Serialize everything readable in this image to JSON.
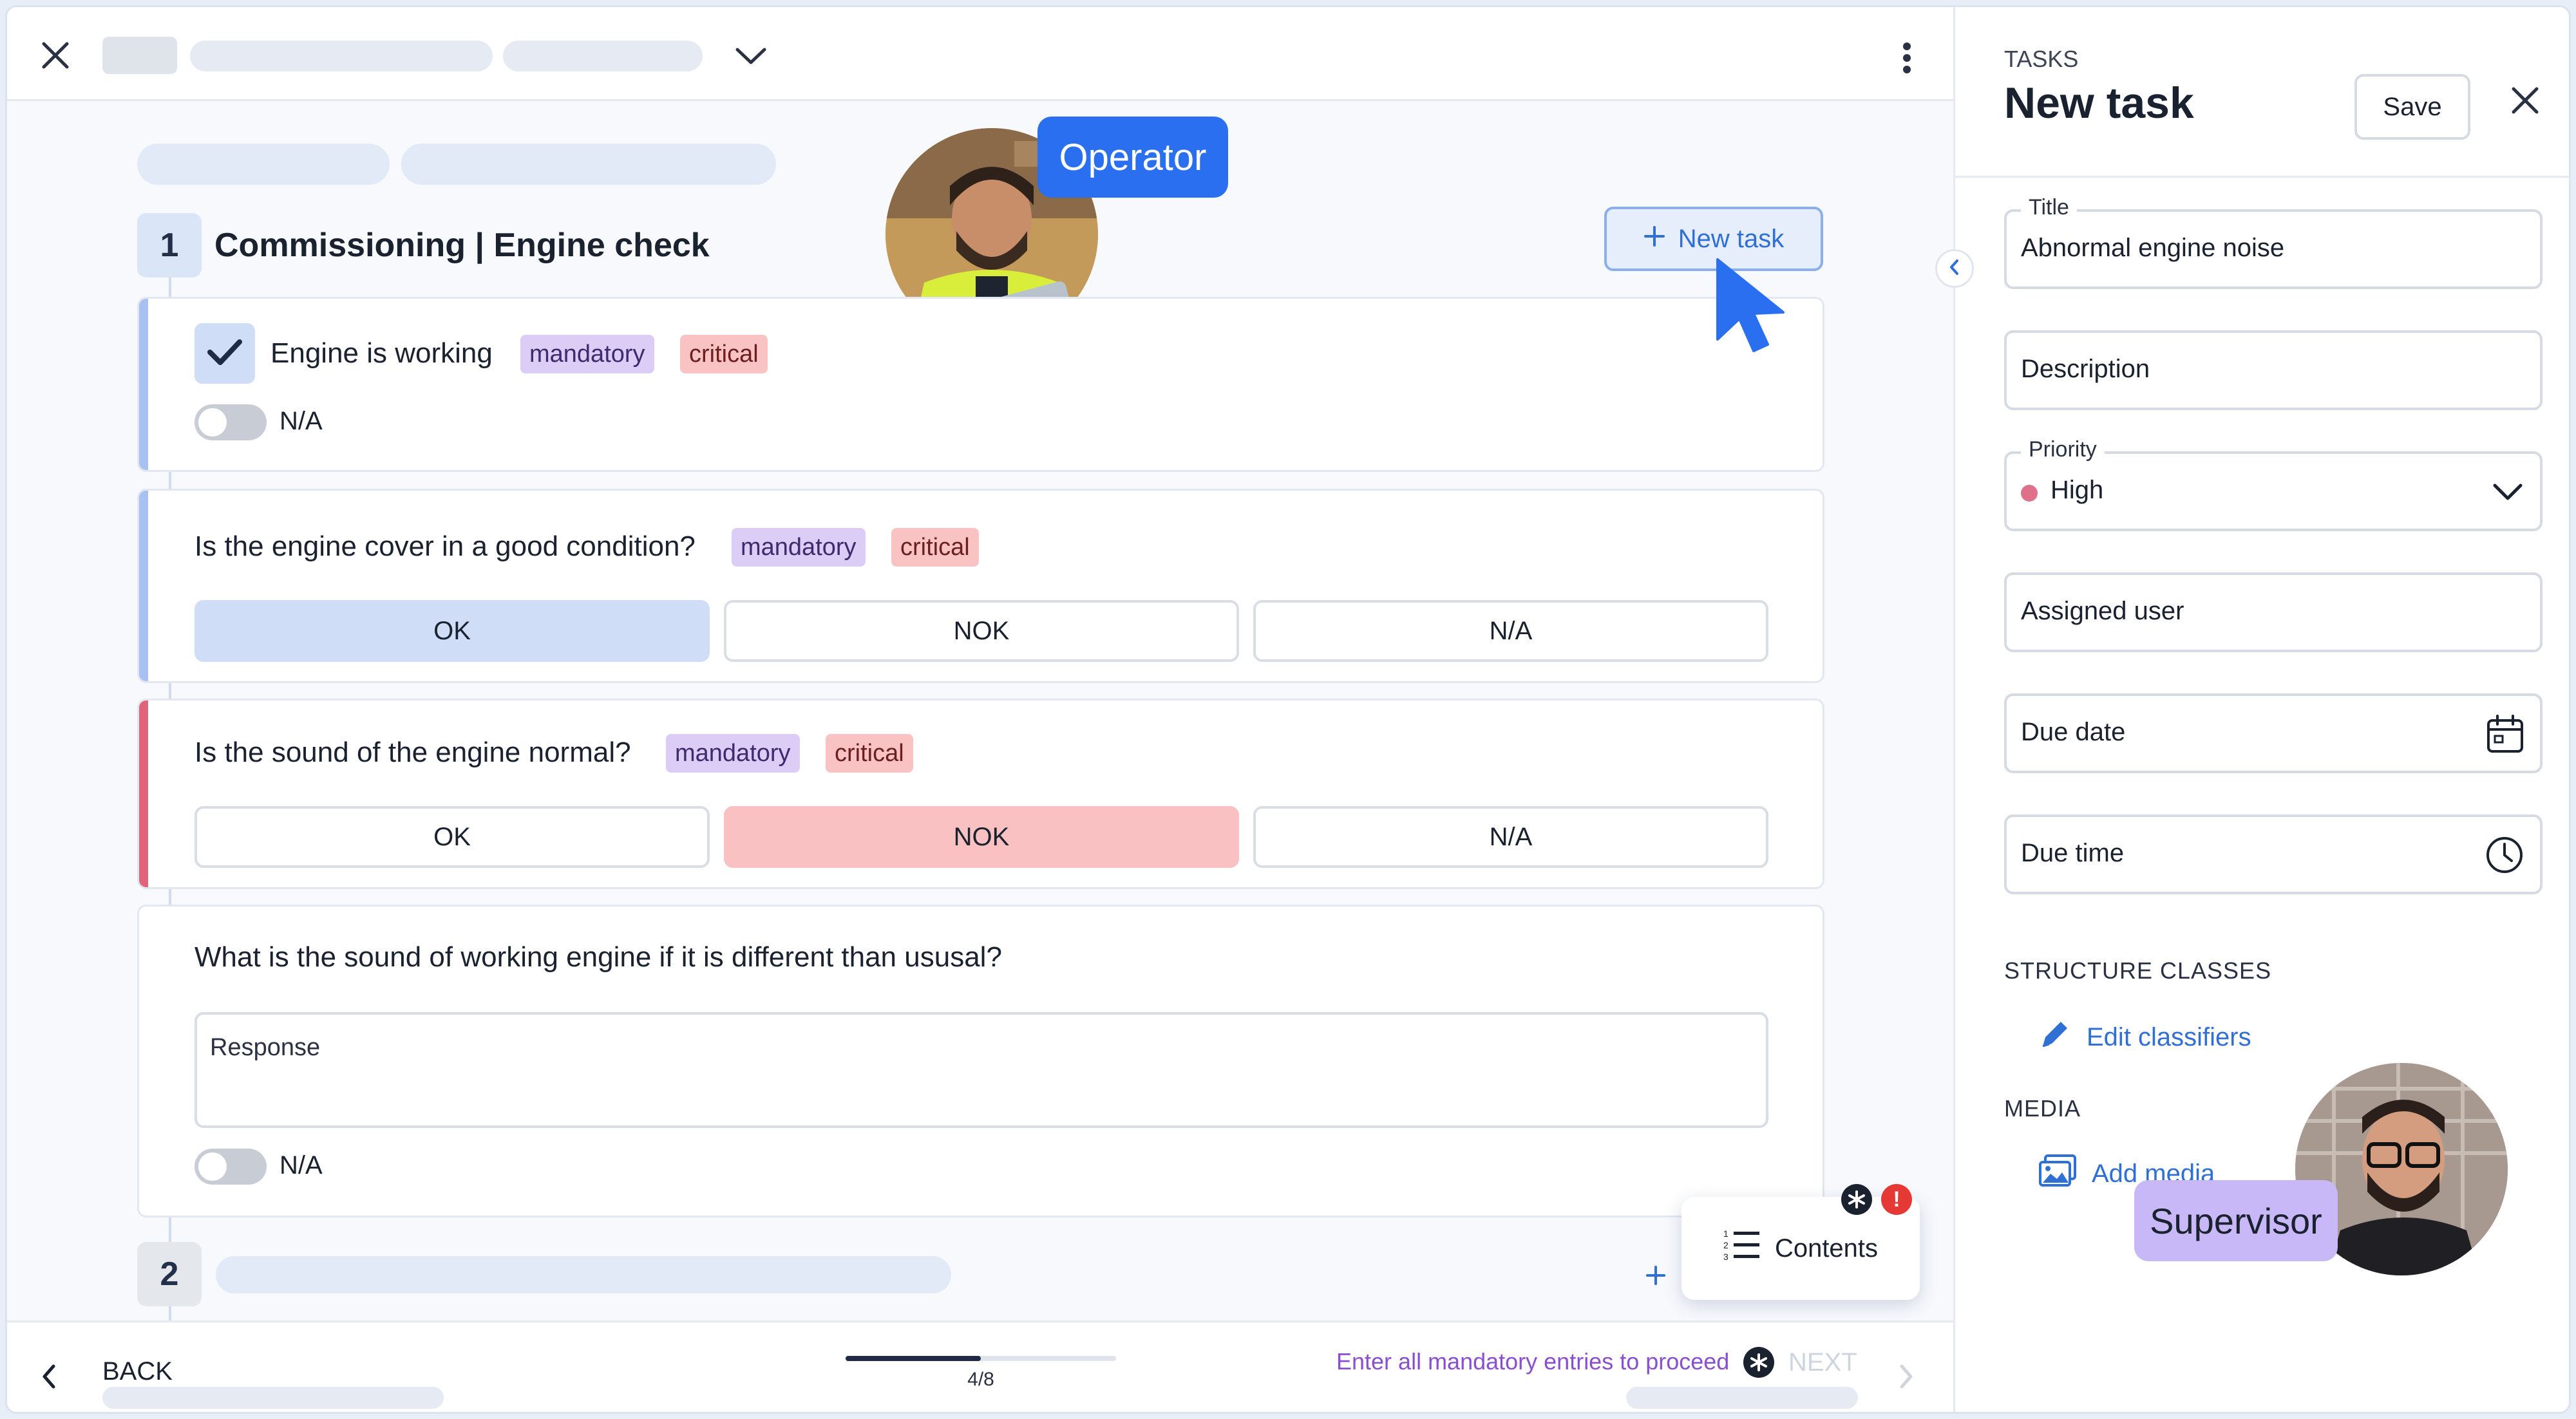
{
  "header": {
    "close_icon": "close-icon",
    "dropdown_icon": "chevron-down-icon",
    "more_icon": "more-vertical-icon"
  },
  "operator_badge": "Operator",
  "section1": {
    "number": "1",
    "title": "Commissioning | Engine check",
    "new_task_label": "New task"
  },
  "questions": [
    {
      "text": "Engine is working",
      "tags": [
        "mandatory",
        "critical"
      ],
      "checked": true,
      "na_label": "N/A"
    },
    {
      "text": "Is the engine cover in a good condition?",
      "tags": [
        "mandatory",
        "critical"
      ],
      "options": [
        "OK",
        "NOK",
        "N/A"
      ],
      "selected": "OK"
    },
    {
      "text": "Is the sound of the engine normal?",
      "tags": [
        "mandatory",
        "critical"
      ],
      "options": [
        "OK",
        "NOK",
        "N/A"
      ],
      "selected": "NOK"
    },
    {
      "text": "What is the sound of working engine if it is different than ususal?",
      "response_placeholder": "Response",
      "na_label": "N/A"
    }
  ],
  "section2": {
    "number": "2"
  },
  "contents_button": "Contents",
  "footer": {
    "back_label": "BACK",
    "progress_text": "4/8",
    "progress_fraction": 0.5,
    "hint": "Enter all mandatory entries to proceed",
    "next_label": "NEXT"
  },
  "panel": {
    "eyebrow": "TASKS",
    "title": "New task",
    "save_label": "Save",
    "fields": {
      "title_label": "Title",
      "title_value": "Abnormal engine noise",
      "description_placeholder": "Description",
      "priority_label": "Priority",
      "priority_value": "High",
      "assigned_placeholder": "Assigned user",
      "due_date_placeholder": "Due date",
      "due_time_placeholder": "Due time"
    },
    "structure_classes_heading": "STRUCTURE CLASSES",
    "edit_classifiers_label": "Edit classifiers",
    "media_heading": "MEDIA",
    "add_media_label": "Add media"
  },
  "supervisor_badge": "Supervisor",
  "colors": {
    "accent": "#2a6ff0",
    "priority_high": "#e0708a",
    "nok_fill": "#f9c1c1",
    "ok_fill": "#cfddf7",
    "supervisor_badge": "#c9b8f7",
    "hint_text": "#8a4fd0"
  }
}
